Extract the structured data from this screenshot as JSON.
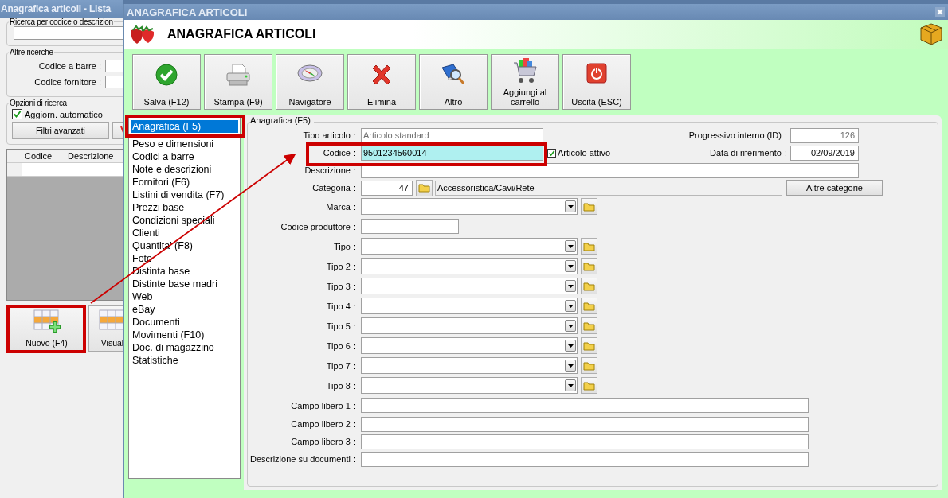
{
  "back_window": {
    "title": "Anagrafica articoli  - Lista",
    "search_group": {
      "title": "Ricerca per codice o descrizion"
    },
    "other_searches": {
      "title": "Altre ricerche",
      "fields": [
        {
          "label": "Codice a barre :"
        },
        {
          "label": "Codice fornitore :"
        }
      ]
    },
    "options": {
      "title": "Opzioni di ricerca",
      "auto_update": {
        "label": "Aggiorn. automatico",
        "checked": true
      },
      "button": "Filtri avanzati"
    },
    "table": {
      "columns": [
        "Codice",
        "Descrizione"
      ]
    },
    "buttons": [
      "Nuovo (F4)",
      "Visual"
    ]
  },
  "dialog": {
    "title": "ANAGRAFICA ARTICOLI",
    "header": "ANAGRAFICA ARTICOLI",
    "toolbar": [
      {
        "label": "Salva (F12)"
      },
      {
        "label": "Stampa (F9)"
      },
      {
        "label": "Navigatore"
      },
      {
        "label": "Elimina"
      },
      {
        "label": "Altro"
      },
      {
        "label": "Aggiungi al carrello"
      },
      {
        "label": "Uscita (ESC)"
      }
    ],
    "nav": {
      "items": [
        {
          "label": "Anagrafica (F5)",
          "selected": true
        },
        {
          "label": "Peso e dimensioni",
          "selected": false
        },
        {
          "label": "Codici a barre",
          "selected": false
        },
        {
          "label": "Note e descrizioni",
          "selected": false
        },
        {
          "label": "Fornitori (F6)",
          "selected": false
        },
        {
          "label": "Listini di vendita (F7)",
          "selected": false
        },
        {
          "label": "Prezzi base",
          "selected": false
        },
        {
          "label": "Condizioni speciali",
          "selected": false
        },
        {
          "label": "Clienti",
          "selected": false
        },
        {
          "label": "Quantita' (F8)",
          "selected": false
        },
        {
          "label": "Foto",
          "selected": false
        },
        {
          "label": "Distinta base",
          "selected": false
        },
        {
          "label": "Distinte base madri",
          "selected": false
        },
        {
          "label": "Web",
          "selected": false
        },
        {
          "label": "eBay",
          "selected": false
        },
        {
          "label": "Documenti",
          "selected": false
        },
        {
          "label": "Movimenti (F10)",
          "selected": false
        },
        {
          "label": "Doc. di magazzino",
          "selected": false
        },
        {
          "label": "Statistiche",
          "selected": false
        }
      ]
    },
    "form": {
      "title": "Anagrafica (F5)",
      "top_rows": [
        {
          "label": "Tipo articolo :",
          "value": "Articolo standard",
          "readonly": true,
          "focused": false,
          "side": {
            "label": "Progressivo interno (ID) :",
            "value": "126",
            "readonly": true
          }
        },
        {
          "label": "Codice :",
          "value": "9501234560014",
          "readonly": false,
          "focused": true,
          "checkbox": {
            "label": "Articolo attivo",
            "checked": true
          },
          "side": {
            "label": "Data di riferimento :",
            "value": "02/09/2019",
            "readonly": false
          }
        }
      ],
      "rows": [
        {
          "kind": "text",
          "label": "Descrizione :"
        },
        {
          "kind": "category",
          "label": "Categoria :",
          "value": "47",
          "name": "Accessoristica/Cavi/Rete",
          "button": "Altre categorie"
        },
        {
          "kind": "combo",
          "label": "Marca :"
        },
        {
          "kind": "short",
          "label": "Codice produttore :"
        },
        {
          "kind": "combo",
          "label": "Tipo :"
        },
        {
          "kind": "combo",
          "label": "Tipo 2 :"
        },
        {
          "kind": "combo",
          "label": "Tipo 3 :"
        },
        {
          "kind": "combo",
          "label": "Tipo 4 :"
        },
        {
          "kind": "combo",
          "label": "Tipo 5 :"
        },
        {
          "kind": "combo",
          "label": "Tipo 6 :"
        },
        {
          "kind": "combo",
          "label": "Tipo 7 :"
        },
        {
          "kind": "combo",
          "label": "Tipo 8 :"
        }
      ],
      "free_fields": [
        {
          "label": "Campo libero 1 :"
        },
        {
          "label": "Campo libero 2 :"
        },
        {
          "label": "Campo libero 3 :"
        },
        {
          "label": "Descrizione su documenti :"
        }
      ]
    }
  }
}
